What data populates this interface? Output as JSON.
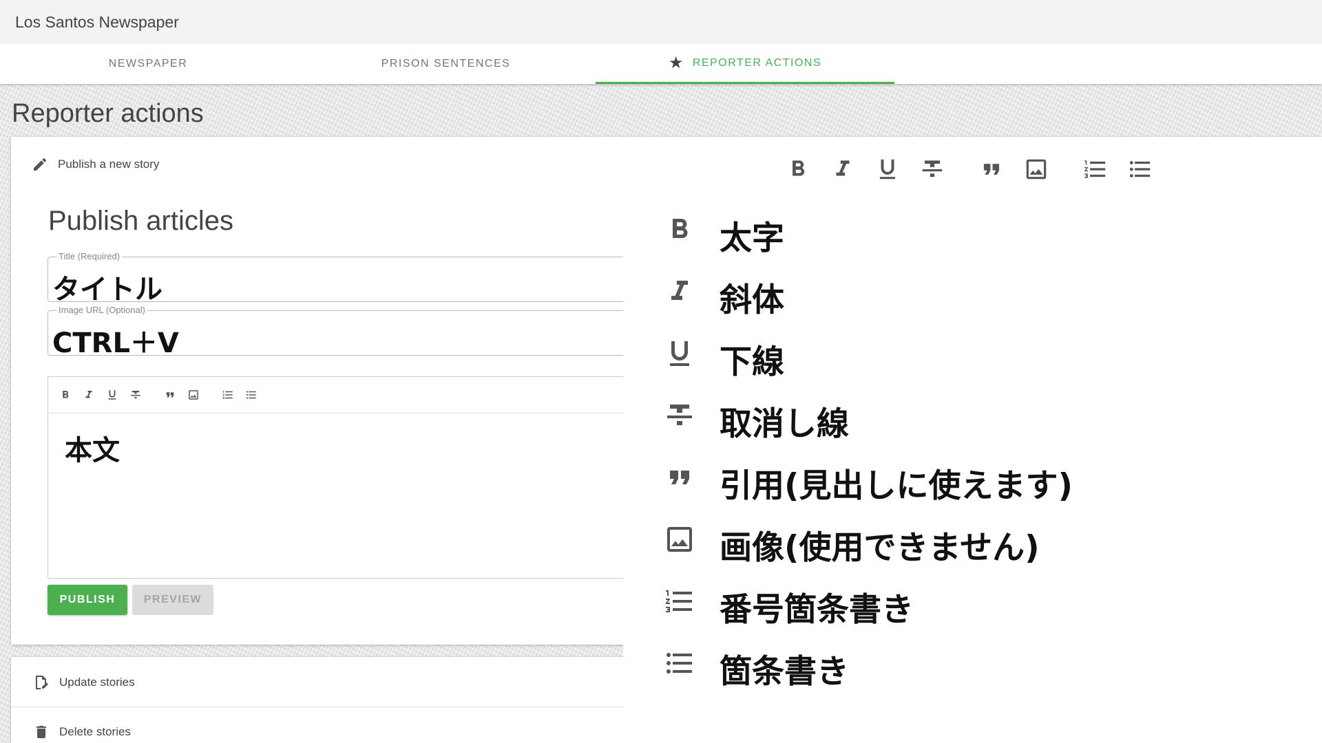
{
  "app": {
    "title": "Los Santos Newspaper"
  },
  "tabs": [
    {
      "label": "NEWSPAPER",
      "active": false
    },
    {
      "label": "PRISON SENTENCES",
      "active": false
    },
    {
      "label": "REPORTER ACTIONS",
      "active": true,
      "icon": "star-icon"
    }
  ],
  "page": {
    "title": "Reporter actions"
  },
  "publish_card": {
    "header": "Publish a new story",
    "section_title": "Publish articles",
    "title_field": {
      "label": "Title (Required)",
      "value": "タイトル"
    },
    "image_field": {
      "label": "Image URL (Optional)",
      "value": "CTRL＋V"
    },
    "editor": {
      "toolbar": [
        "bold-icon",
        "italic-icon",
        "underline-icon",
        "strikethrough-icon",
        "quote-icon",
        "image-icon",
        "numbered-list-icon",
        "bulleted-list-icon"
      ],
      "body": "本文"
    },
    "publish_label": "PUBLISH",
    "preview_label": "PREVIEW"
  },
  "other_actions": [
    {
      "label": "Update stories",
      "icon": "edit-document-icon"
    },
    {
      "label": "Delete stories",
      "icon": "trash-icon"
    }
  ],
  "legend": {
    "items": [
      {
        "icon": "bold-icon",
        "label": "太字"
      },
      {
        "icon": "italic-icon",
        "label": "斜体"
      },
      {
        "icon": "underline-icon",
        "label": "下線"
      },
      {
        "icon": "strikethrough-icon",
        "label": "取消し線"
      },
      {
        "icon": "quote-icon",
        "label": "引用(見出しに使えます)"
      },
      {
        "icon": "image-icon",
        "label": "画像(使用できません)"
      },
      {
        "icon": "numbered-list-icon",
        "label": "番号箇条書き"
      },
      {
        "icon": "bulleted-list-icon",
        "label": "箇条書き"
      }
    ]
  },
  "colors": {
    "accent": "#4caf50",
    "background": "#e9e9e9",
    "titlebar": "#f3f3f3"
  }
}
